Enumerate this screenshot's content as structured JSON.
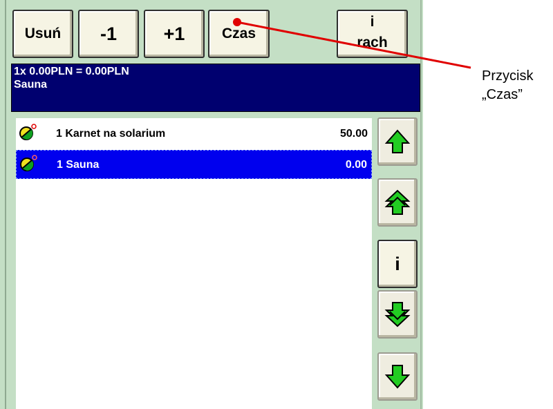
{
  "toolbar": {
    "delete_label": "Usuń",
    "minus_label": "-1",
    "plus_label": "+1",
    "time_label": "Czas",
    "info_line1": "i",
    "info_line2": "rach"
  },
  "info": {
    "line1": "1x 0.00PLN =  0.00PLN",
    "line2": "Sauna"
  },
  "items": [
    {
      "qty_name": "1 Karnet na solarium",
      "price": "50.00"
    },
    {
      "qty_name": "1 Sauna",
      "price": "0.00"
    }
  ],
  "side": {
    "info_label": "i"
  },
  "annotation": {
    "line1": "Przycisk",
    "line2": "„Czas”"
  },
  "colors": {
    "panel": "#c4dfc5",
    "info_bg": "#00006f",
    "selected_row": "#0000ee",
    "arrow_green": "#22cc22",
    "annotation_red": "#e00000"
  }
}
